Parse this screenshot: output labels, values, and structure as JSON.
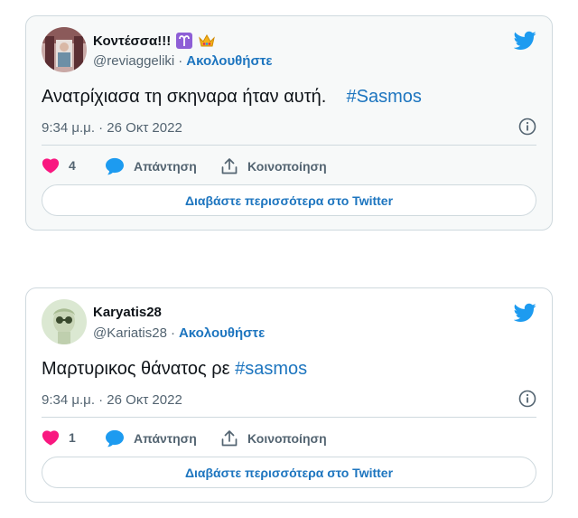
{
  "tweets": [
    {
      "display_name": "Κοντέσσα!!!",
      "name_emojis": [
        "aries-emoji",
        "crown-emoji"
      ],
      "handle": "@reviaggeliki",
      "separator": "·",
      "follow_label": "Ακολουθήστε",
      "text": "Ανατρίχιασα τη σκηναρα ήταν αυτή.",
      "hashtag": "#Sasmos",
      "timestamp": "9:34 μ.μ. · 26 Οκτ 2022",
      "likes": "4",
      "reply_label": "Απάντηση",
      "share_label": "Κοινοποίηση",
      "read_more_label": "Διαβάστε περισσότερα στο Twitter"
    },
    {
      "display_name": "Karyatis28",
      "name_emojis": [],
      "handle": "@Kariatis28",
      "separator": "·",
      "follow_label": "Ακολουθήστε",
      "text": "Μαρτυρικος θάνατος ρε",
      "hashtag": "#sasmos",
      "timestamp": "9:34 μ.μ. · 26 Οκτ 2022",
      "likes": "1",
      "reply_label": "Απάντηση",
      "share_label": "Κοινοποίηση",
      "read_more_label": "Διαβάστε περισσότερα στο Twitter"
    }
  ],
  "colors": {
    "accent": "#1d75bf",
    "twitter_blue": "#1d9bf0",
    "like_red": "#f91880",
    "border": "#cfd9de",
    "muted": "#536471"
  },
  "icons": [
    "twitter-bird-icon",
    "info-icon",
    "heart-icon",
    "reply-bubble-icon",
    "share-icon"
  ]
}
